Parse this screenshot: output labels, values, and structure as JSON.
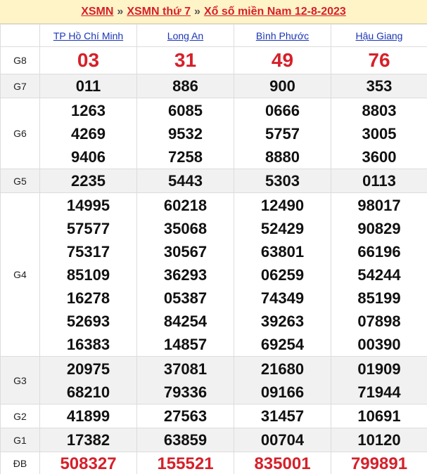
{
  "header": {
    "link1": "XSMN",
    "sep1": "»",
    "link2": "XSMN thứ 7",
    "sep2": "»",
    "link3": "Xổ số miền Nam 12-8-2023"
  },
  "provinces": [
    "TP Hồ Chí Minh",
    "Long An",
    "Bình Phước",
    "Hậu Giang"
  ],
  "prizes": [
    {
      "label": "G8",
      "style": "red",
      "results": [
        [
          "03"
        ],
        [
          "31"
        ],
        [
          "49"
        ],
        [
          "76"
        ]
      ]
    },
    {
      "label": "G7",
      "style": "normal",
      "results": [
        [
          "011"
        ],
        [
          "886"
        ],
        [
          "900"
        ],
        [
          "353"
        ]
      ]
    },
    {
      "label": "G6",
      "style": "normal",
      "results": [
        [
          "1263",
          "4269",
          "9406"
        ],
        [
          "6085",
          "9532",
          "7258"
        ],
        [
          "0666",
          "5757",
          "8880"
        ],
        [
          "8803",
          "3005",
          "3600"
        ]
      ]
    },
    {
      "label": "G5",
      "style": "normal",
      "results": [
        [
          "2235"
        ],
        [
          "5443"
        ],
        [
          "5303"
        ],
        [
          "0113"
        ]
      ]
    },
    {
      "label": "G4",
      "style": "normal",
      "results": [
        [
          "14995",
          "57577",
          "75317",
          "85109",
          "16278",
          "52693",
          "16383"
        ],
        [
          "60218",
          "35068",
          "30567",
          "36293",
          "05387",
          "84254",
          "14857"
        ],
        [
          "12490",
          "52429",
          "63801",
          "06259",
          "74349",
          "39263",
          "69254"
        ],
        [
          "98017",
          "90829",
          "66196",
          "54244",
          "85199",
          "07898",
          "00390"
        ]
      ]
    },
    {
      "label": "G3",
      "style": "normal",
      "results": [
        [
          "20975",
          "68210"
        ],
        [
          "37081",
          "79336"
        ],
        [
          "21680",
          "09166"
        ],
        [
          "01909",
          "71944"
        ]
      ]
    },
    {
      "label": "G2",
      "style": "normal",
      "results": [
        [
          "41899"
        ],
        [
          "27563"
        ],
        [
          "31457"
        ],
        [
          "10691"
        ]
      ]
    },
    {
      "label": "G1",
      "style": "normal",
      "results": [
        [
          "17382"
        ],
        [
          "63859"
        ],
        [
          "00704"
        ],
        [
          "10120"
        ]
      ]
    },
    {
      "label": "ĐB",
      "style": "redb",
      "results": [
        [
          "508327"
        ],
        [
          "155521"
        ],
        [
          "835001"
        ],
        [
          "799891"
        ]
      ]
    }
  ],
  "colors": {
    "accent_red": "#d6202a",
    "link_blue": "#1a35b5",
    "header_bg": "#fff4c8",
    "alt_row_bg": "#f1f1f1"
  }
}
